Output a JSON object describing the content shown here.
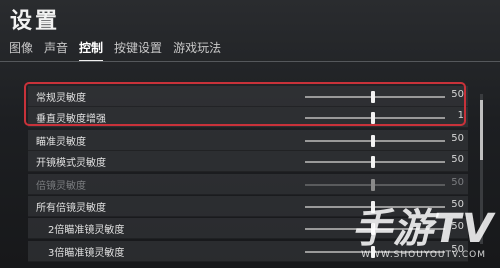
{
  "header": {
    "title": "设置"
  },
  "tabs": [
    {
      "label": "图像",
      "active": false
    },
    {
      "label": "声音",
      "active": false
    },
    {
      "label": "控制",
      "active": true
    },
    {
      "label": "按键设置",
      "active": false
    },
    {
      "label": "游戏玩法",
      "active": false
    }
  ],
  "settings": [
    {
      "label": "常规灵敏度",
      "value": "50",
      "slider_fraction": 0.47,
      "dim": false
    },
    {
      "label": "垂直灵敏度增强",
      "value": "1",
      "slider_fraction": 0.47,
      "dim": false
    },
    {
      "label": "瞄准灵敏度",
      "value": "50",
      "slider_fraction": 0.47,
      "dim": false
    },
    {
      "label": "开镜模式灵敏度",
      "value": "50",
      "slider_fraction": 0.47,
      "dim": false
    },
    {
      "label": "倍镜灵敏度",
      "value": "50",
      "slider_fraction": 0.47,
      "dim": true
    },
    {
      "label": "所有倍镜灵敏度",
      "value": "50",
      "slider_fraction": 0.47,
      "dim": false
    },
    {
      "label": "2倍瞄准镜灵敏度",
      "value": "50",
      "slider_fraction": 0.47,
      "dim": false
    },
    {
      "label": "3倍瞄准镜灵敏度",
      "value": "50",
      "slider_fraction": 0.47,
      "dim": false
    }
  ],
  "watermark": {
    "text": "手游TV",
    "url": "WWW.SHOUYOUTV.COM"
  },
  "colors": {
    "highlight": "#c8323a",
    "text": "#e6e6e6"
  }
}
